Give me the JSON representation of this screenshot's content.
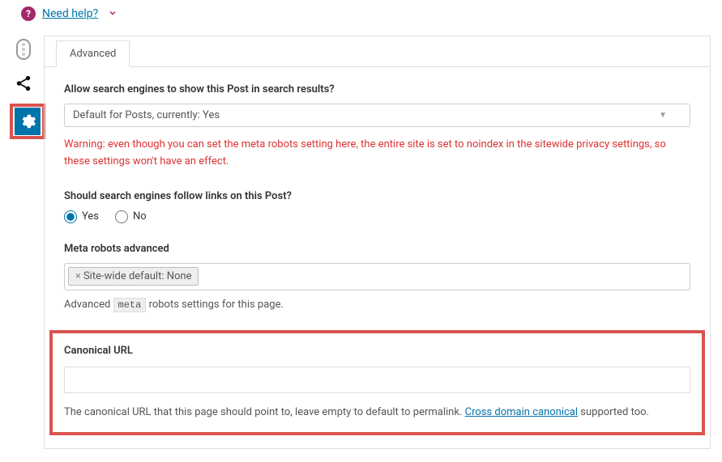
{
  "topbar": {
    "need_help": "Need help?"
  },
  "tabs": {
    "advanced": "Advanced"
  },
  "search_results": {
    "label": "Allow search engines to show this Post in search results?",
    "selected": "Default for Posts, currently: Yes",
    "warning": "Warning: even though you can set the meta robots setting here, the entire site is set to noindex in the sitewide privacy settings, so these settings won't have an effect."
  },
  "follow_links": {
    "label": "Should search engines follow links on this Post?",
    "yes": "Yes",
    "no": "No"
  },
  "meta_robots": {
    "label": "Meta robots advanced",
    "chip": "Site-wide default: None",
    "help_prefix": "Advanced ",
    "help_code": "meta",
    "help_suffix": " robots settings for this page."
  },
  "canonical": {
    "label": "Canonical URL",
    "value": "",
    "help_prefix": "The canonical URL that this page should point to, leave empty to default to permalink. ",
    "link_text": "Cross domain canonical",
    "help_suffix": " supported too."
  }
}
